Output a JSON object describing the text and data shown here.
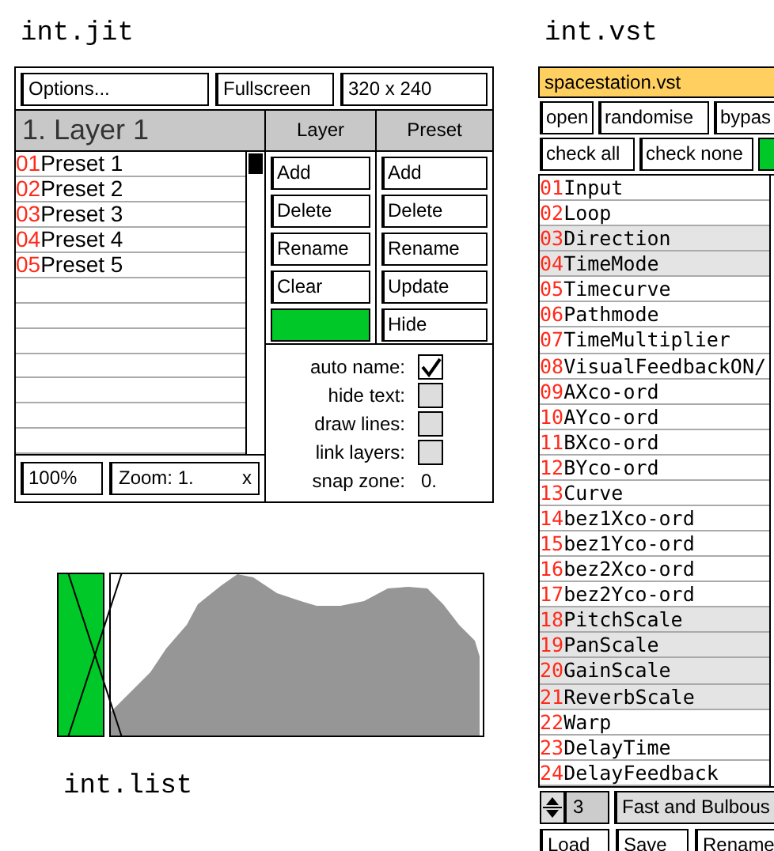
{
  "jit": {
    "title": "int.jit",
    "options": "Options...",
    "fullscreen": "Fullscreen",
    "size": "320 x 240",
    "layer_name": "1. Layer 1",
    "column_headers": [
      "Layer",
      "Preset"
    ],
    "presets": [
      {
        "number": "01",
        "name": "Preset 1"
      },
      {
        "number": "02",
        "name": "Preset 2"
      },
      {
        "number": "03",
        "name": "Preset 3"
      },
      {
        "number": "04",
        "name": "Preset 4"
      },
      {
        "number": "05",
        "name": "Preset 5"
      }
    ],
    "layer_buttons": [
      {
        "kind": "text",
        "label": "Add"
      },
      {
        "kind": "text",
        "label": "Delete"
      },
      {
        "kind": "text",
        "label": "Rename"
      },
      {
        "kind": "text",
        "label": "Clear"
      },
      {
        "kind": "swatch",
        "color": "#00c828"
      }
    ],
    "preset_buttons": [
      "Add",
      "Delete",
      "Rename",
      "Update",
      "Hide"
    ],
    "zoom_percent": "100%",
    "zoom": "Zoom: 1.",
    "zoom_close": "x",
    "settings": [
      {
        "kind": "checkbox",
        "label": "auto name:",
        "checked": true
      },
      {
        "kind": "checkbox",
        "label": "hide text:",
        "checked": false
      },
      {
        "kind": "checkbox",
        "label": "draw lines:",
        "checked": false
      },
      {
        "kind": "checkbox",
        "label": "link layers:",
        "checked": false
      },
      {
        "kind": "value",
        "label": "snap zone:",
        "value": "0."
      }
    ]
  },
  "vst": {
    "title": "int.vst",
    "plugin": "spacestation.vst",
    "buttons": [
      "open",
      "randomise",
      "bypas"
    ],
    "check_buttons": [
      "check all",
      "check none"
    ],
    "toggle": {
      "on": true
    },
    "params": [
      {
        "number": "01",
        "name": "Input",
        "selected": false
      },
      {
        "number": "02",
        "name": "Loop",
        "selected": false
      },
      {
        "number": "03",
        "name": "Direction",
        "selected": true
      },
      {
        "number": "04",
        "name": "TimeMode",
        "selected": true
      },
      {
        "number": "05",
        "name": "Timecurve",
        "selected": false
      },
      {
        "number": "06",
        "name": "Pathmode",
        "selected": false
      },
      {
        "number": "07",
        "name": "TimeMultiplier",
        "selected": false
      },
      {
        "number": "08",
        "name": "VisualFeedbackON/",
        "selected": false
      },
      {
        "number": "09",
        "name": "AXco-ord",
        "selected": false
      },
      {
        "number": "10",
        "name": "AYco-ord",
        "selected": false
      },
      {
        "number": "11",
        "name": "BXco-ord",
        "selected": false
      },
      {
        "number": "12",
        "name": "BYco-ord",
        "selected": false
      },
      {
        "number": "13",
        "name": "Curve",
        "selected": false
      },
      {
        "number": "14",
        "name": "bez1Xco-ord",
        "selected": false
      },
      {
        "number": "15",
        "name": "bez1Yco-ord",
        "selected": false
      },
      {
        "number": "16",
        "name": "bez2Xco-ord",
        "selected": false
      },
      {
        "number": "17",
        "name": "bez2Yco-ord",
        "selected": false
      },
      {
        "number": "18",
        "name": "PitchScale",
        "selected": true
      },
      {
        "number": "19",
        "name": "PanScale",
        "selected": true
      },
      {
        "number": "20",
        "name": "GainScale",
        "selected": true
      },
      {
        "number": "21",
        "name": "ReverbScale",
        "selected": true
      },
      {
        "number": "22",
        "name": "Warp",
        "selected": false
      },
      {
        "number": "23",
        "name": "DelayTime",
        "selected": false
      },
      {
        "number": "24",
        "name": "DelayFeedback",
        "selected": false
      }
    ],
    "preset_number": "3",
    "preset_name": "Fast and Bulbous",
    "file_buttons": [
      "Load",
      "Save",
      "Rename"
    ]
  },
  "list": {
    "title": "int.list"
  }
}
